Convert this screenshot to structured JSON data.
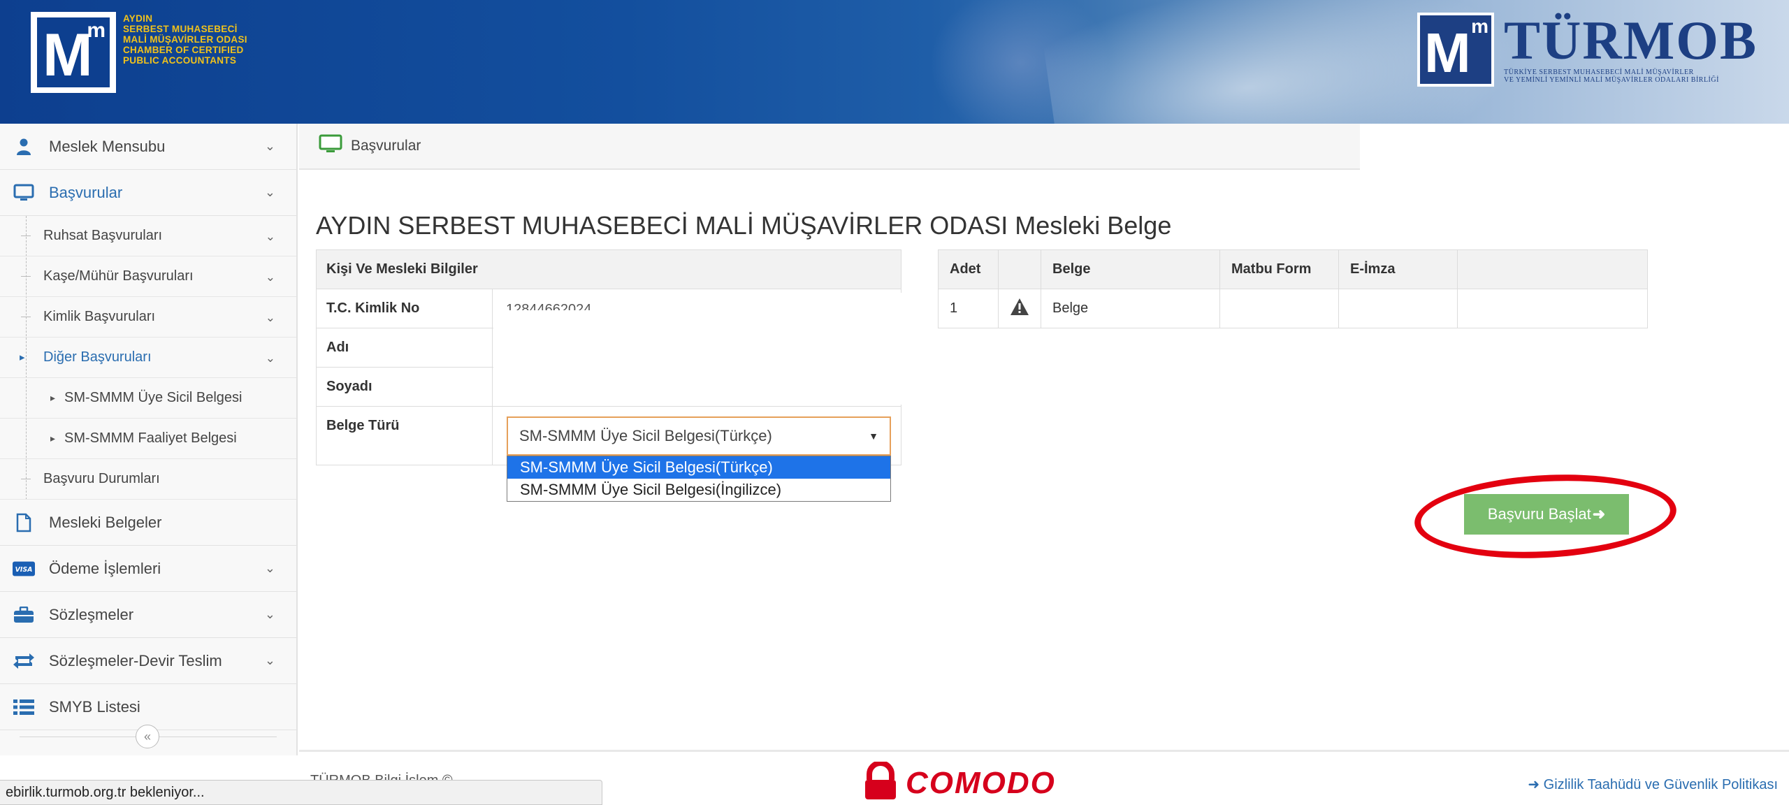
{
  "header": {
    "left_logo_lines": [
      "AYDIN",
      "SERBEST MUHASEBECİ",
      "MALİ MÜŞAVİRLER ODASI",
      "CHAMBER OF CERTIFIED",
      "PUBLIC ACCOUNTANTS"
    ],
    "right_logo_name": "TÜRMOB",
    "right_logo_sub_1": "TÜRKİYE SERBEST MUHASEBECİ MALİ MÜŞAVİRLER",
    "right_logo_sub_2": "VE YEMİNLİ YEMİNLİ MALİ MÜŞAVİRLER ODALARI BİRLİĞİ"
  },
  "sidebar": {
    "items": [
      {
        "label": "Meslek Mensubu"
      },
      {
        "label": "Başvurular"
      },
      {
        "label": "Mesleki Belgeler"
      },
      {
        "label": "Ödeme İşlemleri"
      },
      {
        "label": "Sözleşmeler"
      },
      {
        "label": "Sözleşmeler-Devir Teslim"
      },
      {
        "label": "SMYB Listesi"
      }
    ],
    "sub_items": [
      {
        "label": "Ruhsat Başvuruları"
      },
      {
        "label": "Kaşe/Mühür Başvuruları"
      },
      {
        "label": "Kimlik Başvuruları"
      },
      {
        "label": "Diğer Başvuruları"
      },
      {
        "label": "Başvuru Durumları"
      }
    ],
    "subsub_items": [
      {
        "label": "SM-SMMM Üye Sicil Belgesi"
      },
      {
        "label": "SM-SMMM Faaliyet Belgesi"
      }
    ],
    "collapse_glyph": "«"
  },
  "breadcrumb": {
    "label": "Başvurular"
  },
  "page": {
    "title": "AYDIN SERBEST MUHASEBECİ MALİ MÜŞAVİRLER ODASI Mesleki Belge"
  },
  "info_table": {
    "header": "Kişi Ve Mesleki Bilgiler",
    "rows": [
      {
        "label": "T.C. Kimlik No",
        "value": "12844662024"
      },
      {
        "label": "Adı"
      },
      {
        "label": "Soyadı"
      },
      {
        "label": "Belge Türü"
      }
    ]
  },
  "belge_select": {
    "value": "SM-SMMM Üye Sicil Belgesi(Türkçe)",
    "options": [
      "SM-SMMM Üye Sicil Belgesi(Türkçe)",
      "SM-SMMM Üye Sicil Belgesi(İngilizce)"
    ]
  },
  "doc_table": {
    "headers": [
      "Adet",
      "",
      "Belge",
      "Matbu Form",
      "E-İmza",
      ""
    ],
    "rows": [
      {
        "adet": "1",
        "icon": "warning-icon",
        "belge": "Belge"
      }
    ]
  },
  "start_button": {
    "label": "Başvuru Başlat"
  },
  "footer": {
    "left": "TÜRMOB Bilgi İşlem ©",
    "comodo": "COMODO",
    "privacy": "Gizlilik Taahüdü ve Güvenlik Politikası"
  },
  "status_bar": {
    "text": "ebirlik.turmob.org.tr bekleniyor..."
  },
  "colors": {
    "header_blue": "#0d3f8f",
    "link_blue": "#2a6db0",
    "button_green": "#7bbd6e",
    "annotation_red": "#e3000f",
    "option_selected": "#1e73e8"
  }
}
